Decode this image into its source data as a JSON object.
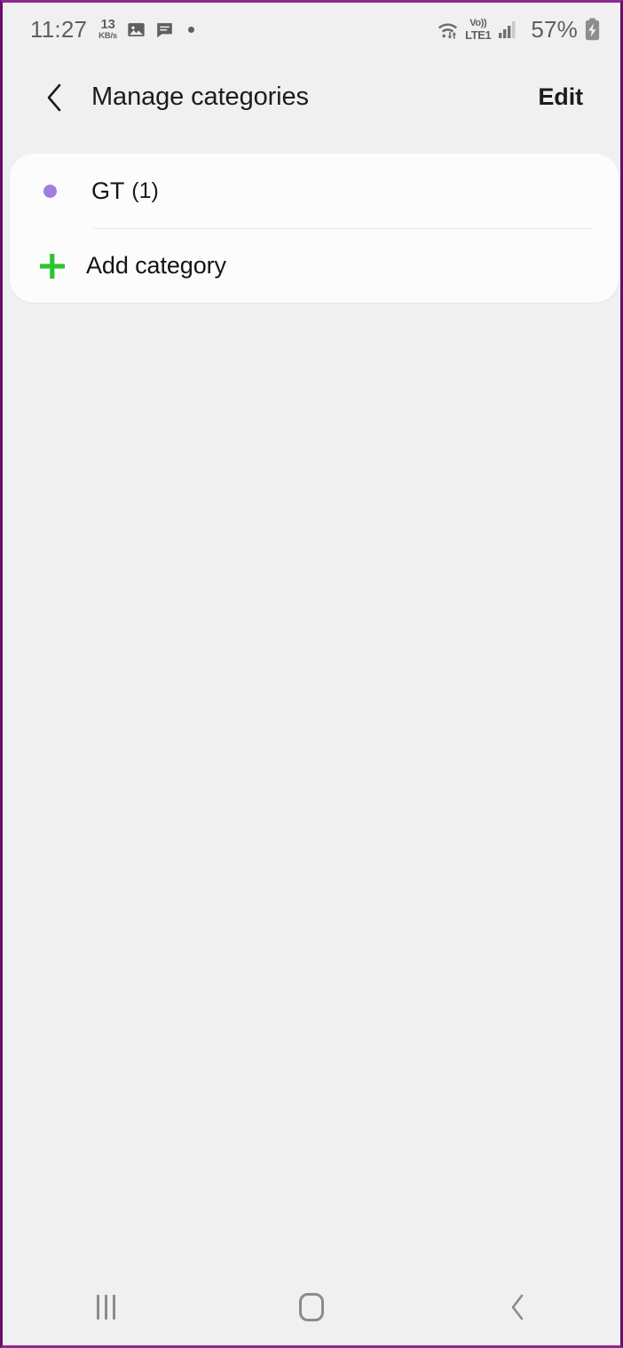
{
  "status_bar": {
    "time": "11:27",
    "network_speed_value": "13",
    "network_speed_unit": "KB/s",
    "icons": [
      "gallery-icon",
      "message-icon",
      "notification-dot"
    ],
    "wifi": "wifi-with-transfer-arrows",
    "volte_top": "Vo))",
    "volte_bottom": "LTE1",
    "signal": "signal-bars-icon",
    "battery_percent": "57%",
    "battery_state": "charging"
  },
  "header": {
    "back_icon": "chevron-left-icon",
    "title": "Manage categories",
    "edit_label": "Edit"
  },
  "card": {
    "categories": [
      {
        "name": "GT",
        "count": "(1)",
        "dot_color": "#a07ee0"
      }
    ],
    "add_category_label": "Add category",
    "add_icon_color": "#2ec431"
  },
  "nav_bar": {
    "recents_label": "recents-icon",
    "home_label": "home-icon",
    "back_label": "back-icon"
  },
  "theme": {
    "background": "#f1f0f0",
    "card_background": "#fcfcfc",
    "frame_border": "#6d0a6d",
    "text_primary": "#141414",
    "text_status": "#5f5f5f",
    "nav_icon": "#8b8b8b"
  }
}
